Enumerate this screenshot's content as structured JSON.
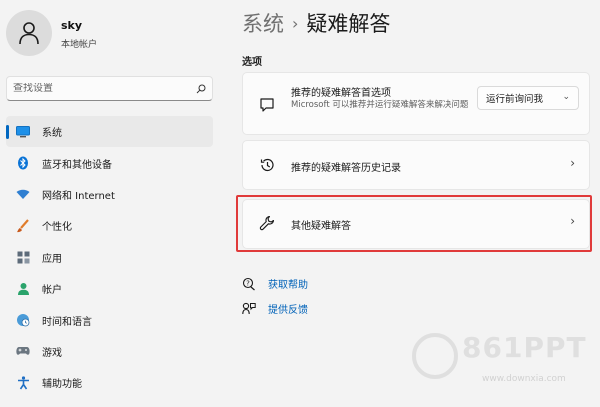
{
  "user": {
    "name": "sky",
    "account_type": "本地帐户"
  },
  "search": {
    "placeholder": "查找设置"
  },
  "sidebar": {
    "items": [
      {
        "label": "系统",
        "icon": "display-icon",
        "active": true
      },
      {
        "label": "蓝牙和其他设备",
        "icon": "bluetooth-icon"
      },
      {
        "label": "网络和 Internet",
        "icon": "wifi-icon"
      },
      {
        "label": "个性化",
        "icon": "paintbrush-icon"
      },
      {
        "label": "应用",
        "icon": "apps-icon"
      },
      {
        "label": "帐户",
        "icon": "person-icon"
      },
      {
        "label": "时间和语言",
        "icon": "globe-clock-icon"
      },
      {
        "label": "游戏",
        "icon": "gamepad-icon"
      },
      {
        "label": "辅助功能",
        "icon": "accessibility-icon"
      }
    ]
  },
  "breadcrumb": {
    "parent": "系统",
    "separator": "›",
    "current": "疑难解答"
  },
  "section": {
    "label": "选项"
  },
  "cards": {
    "preferences": {
      "title": "推荐的疑难解答首选项",
      "description": "Microsoft 可以推荐并运行疑难解答来解决问题",
      "dropdown_value": "运行前询问我"
    },
    "history": {
      "title": "推荐的疑难解答历史记录"
    },
    "other": {
      "title": "其他疑难解答"
    }
  },
  "links": {
    "get_help": "获取帮助",
    "give_feedback": "提供反馈"
  },
  "watermark": {
    "brand": "861PPT",
    "site": "www.downxia.com"
  },
  "colors": {
    "accent": "#0067c0",
    "highlight_border": "#e03a3a",
    "link": "#0062b8"
  }
}
